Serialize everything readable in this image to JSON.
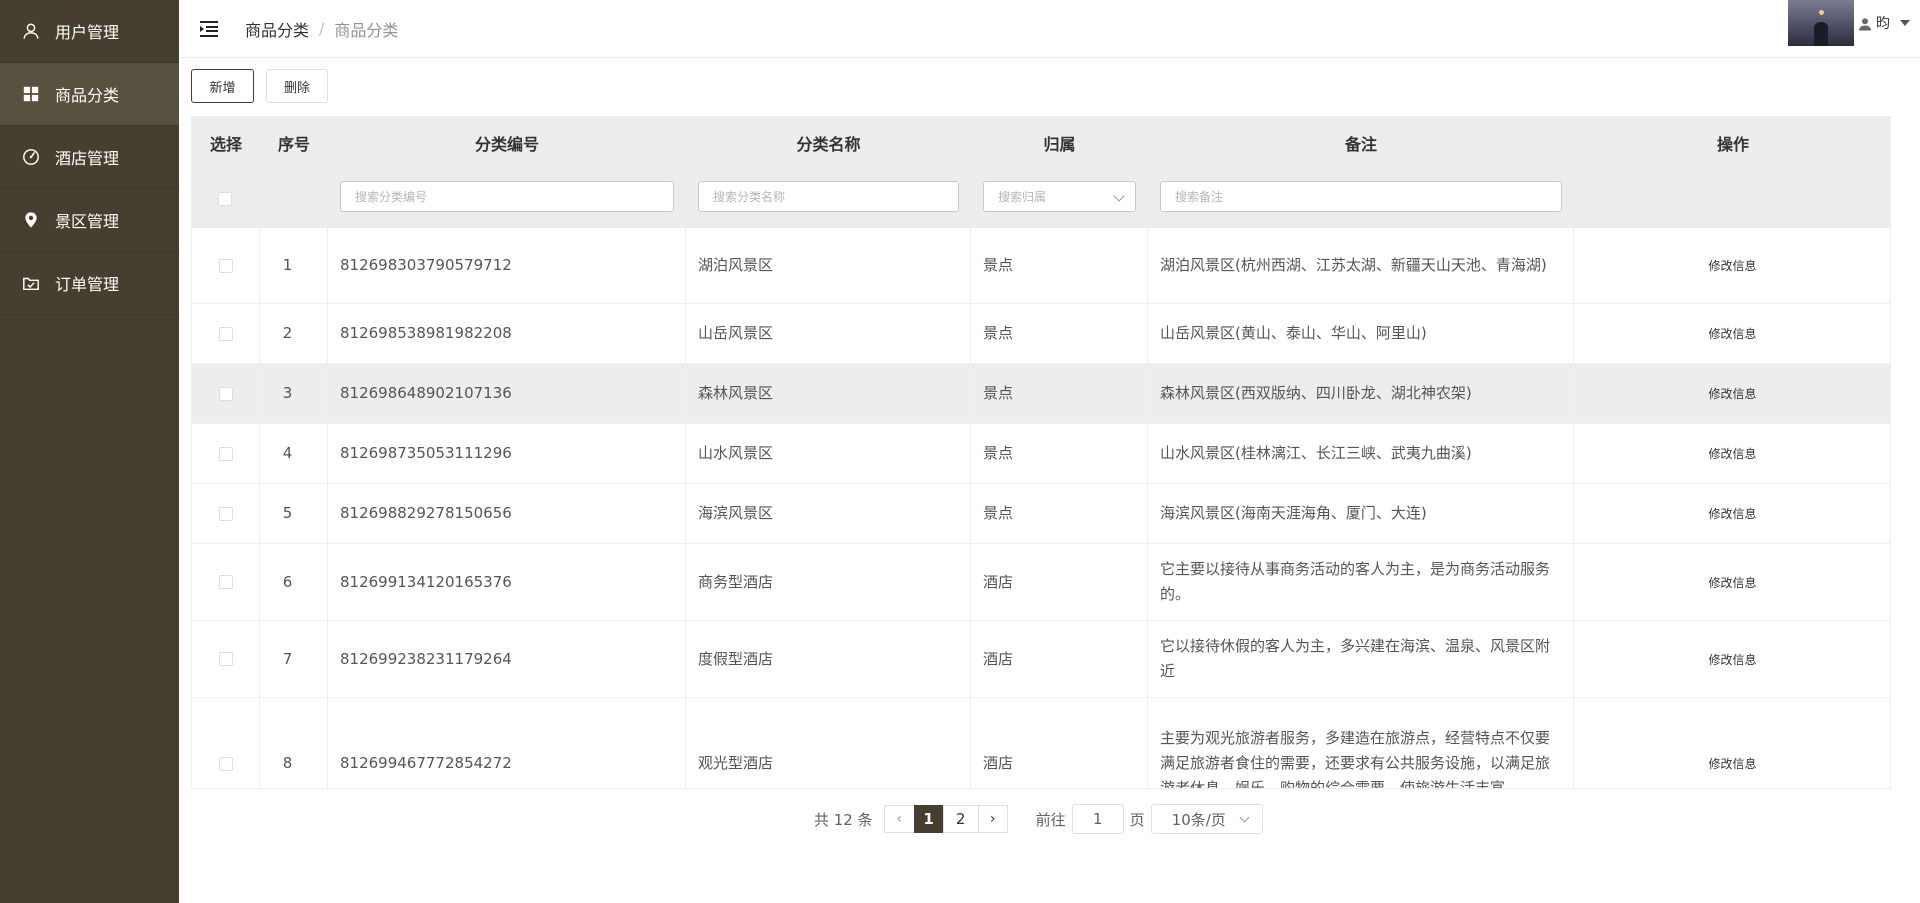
{
  "sidebar": {
    "items": [
      {
        "label": "用户管理",
        "icon": "user-icon"
      },
      {
        "label": "商品分类",
        "icon": "grid-icon"
      },
      {
        "label": "酒店管理",
        "icon": "gauge-icon"
      },
      {
        "label": "景区管理",
        "icon": "location-pin-icon"
      },
      {
        "label": "订单管理",
        "icon": "order-box-icon"
      }
    ],
    "active_index": 1,
    "background": "#463f30"
  },
  "header": {
    "breadcrumb": [
      "商品分类",
      "商品分类"
    ],
    "separator": "/",
    "user_name": "昀"
  },
  "toolbar": {
    "add_label": "新增",
    "delete_label": "删除"
  },
  "table": {
    "columns": [
      "选择",
      "序号",
      "分类编号",
      "分类名称",
      "归属",
      "备注",
      "操作"
    ],
    "filters": {
      "code_placeholder": "搜索分类编号",
      "name_placeholder": "搜索分类名称",
      "belong_placeholder": "搜索归属",
      "remark_placeholder": "搜索备注"
    },
    "rows": [
      {
        "index": "1",
        "code": "812698303790579712",
        "name": "湖泊风景区",
        "belong": "景点",
        "remark": "湖泊风景区(杭州西湖、江苏太湖、新疆天山天池、青海湖)",
        "action": "修改信息"
      },
      {
        "index": "2",
        "code": "812698538981982208",
        "name": "山岳风景区",
        "belong": "景点",
        "remark": "山岳风景区(黄山、泰山、华山、阿里山)",
        "action": "修改信息"
      },
      {
        "index": "3",
        "code": "812698648902107136",
        "name": "森林风景区",
        "belong": "景点",
        "remark": "森林风景区(西双版纳、四川卧龙、湖北神农架)",
        "action": "修改信息"
      },
      {
        "index": "4",
        "code": "812698735053111296",
        "name": "山水风景区",
        "belong": "景点",
        "remark": "山水风景区(桂林漓江、长江三峡、武夷九曲溪)",
        "action": "修改信息"
      },
      {
        "index": "5",
        "code": "812698829278150656",
        "name": "海滨风景区",
        "belong": "景点",
        "remark": "海滨风景区(海南天涯海角、厦门、大连)",
        "action": "修改信息"
      },
      {
        "index": "6",
        "code": "812699134120165376",
        "name": "商务型酒店",
        "belong": "酒店",
        "remark": "它主要以接待从事商务活动的客人为主，是为商务活动服务的。",
        "action": "修改信息"
      },
      {
        "index": "7",
        "code": "812699238231179264",
        "name": "度假型酒店",
        "belong": "酒店",
        "remark": "它以接待休假的客人为主，多兴建在海滨、温泉、风景区附近",
        "action": "修改信息"
      },
      {
        "index": "8",
        "code": "812699467772854272",
        "name": "观光型酒店",
        "belong": "酒店",
        "remark": "主要为观光旅游者服务，多建造在旅游点，经营特点不仅要满足旅游者食住的需要，还要求有公共服务设施，以满足旅游者休息、娱乐、购物的综合需要，使旅游生活丰富",
        "action": "修改信息"
      }
    ],
    "hover_row_index": 2
  },
  "pagination": {
    "total_text": "共 12 条",
    "pages": [
      "1",
      "2"
    ],
    "current_page": "1",
    "goto_label": "前往",
    "goto_value": "1",
    "page_unit": "页",
    "page_size": "10条/页"
  }
}
